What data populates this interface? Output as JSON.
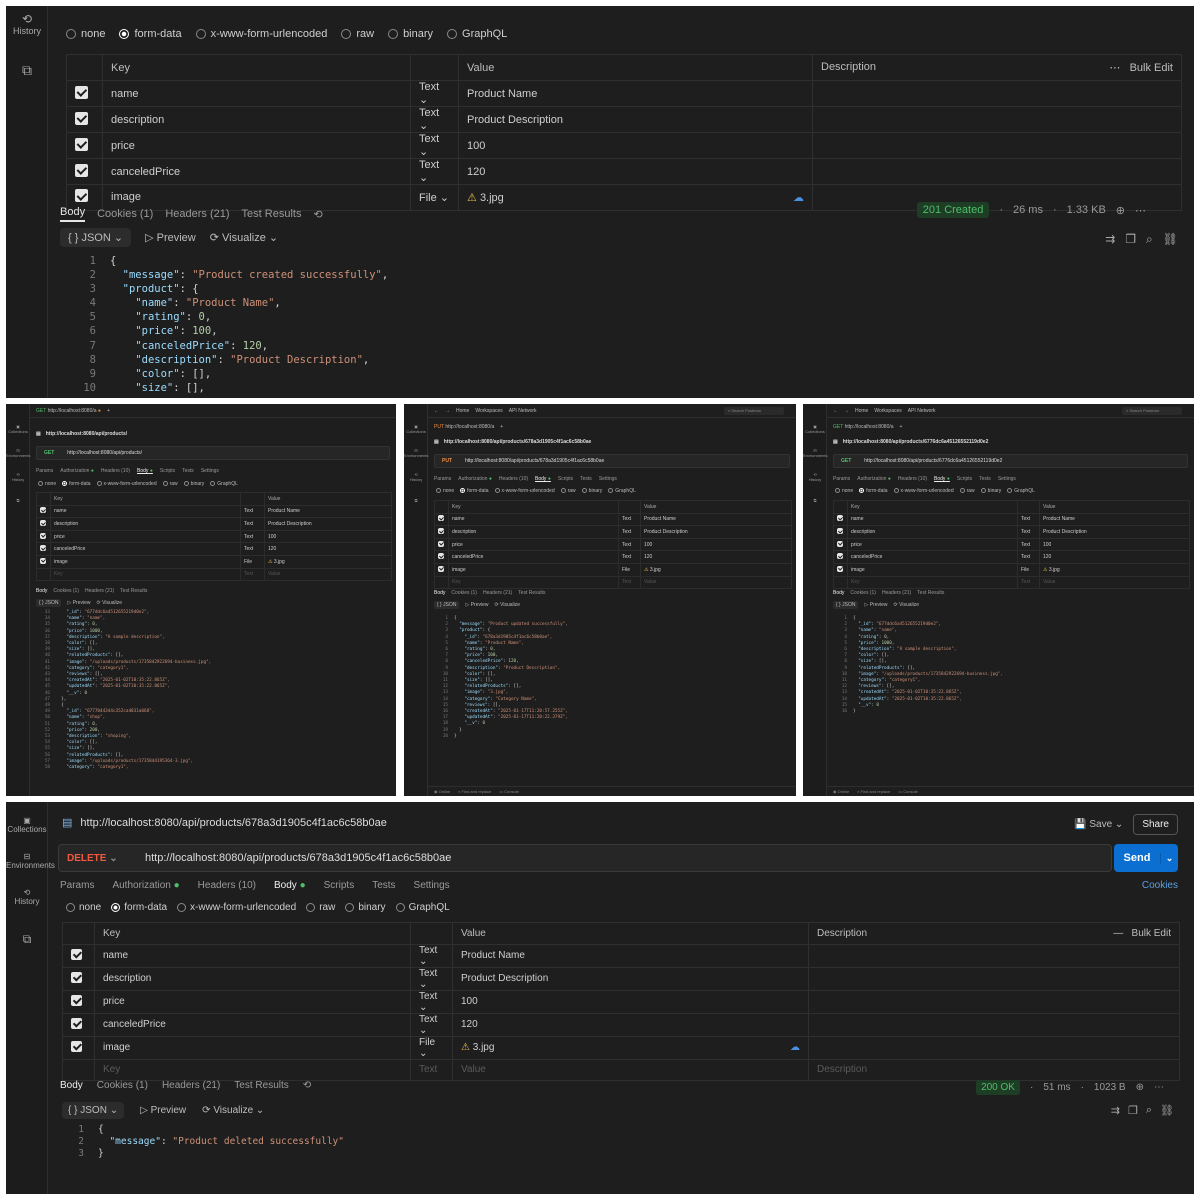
{
  "panel1": {
    "sidebar": {
      "history": "History"
    },
    "body_types": [
      "none",
      "form-data",
      "x-www-form-urlencoded",
      "raw",
      "binary",
      "GraphQL"
    ],
    "selected_body_type": "form-data",
    "table_headers": {
      "key": "Key",
      "value": "Value",
      "description": "Description",
      "bulk": "Bulk Edit"
    },
    "rows": [
      {
        "key": "name",
        "type": "Text",
        "value": "Product Name"
      },
      {
        "key": "description",
        "type": "Text",
        "value": "Product Description"
      },
      {
        "key": "price",
        "type": "Text",
        "value": "100"
      },
      {
        "key": "canceledPrice",
        "type": "Text",
        "value": "120"
      },
      {
        "key": "image",
        "type": "File",
        "value": "3.jpg"
      }
    ],
    "response_tabs": [
      "Body",
      "Cookies (1)",
      "Headers (21)",
      "Test Results"
    ],
    "status": "201 Created",
    "time": "26 ms",
    "size": "1.33 KB",
    "view": {
      "format": "JSON",
      "preview": "Preview",
      "visualize": "Visualize"
    },
    "code": [
      {
        "ln": "1",
        "t": "{"
      },
      {
        "ln": "2",
        "k": "\"message\"",
        "v": "\"Product created successfully\"",
        "e": ","
      },
      {
        "ln": "3",
        "k": "\"product\"",
        "v": "",
        "e": "{"
      },
      {
        "ln": "4",
        "k": "\"name\"",
        "v": "\"Product Name\"",
        "e": ",",
        "i": 2
      },
      {
        "ln": "5",
        "k": "\"rating\"",
        "n": "0",
        "e": ",",
        "i": 2
      },
      {
        "ln": "6",
        "k": "\"price\"",
        "n": "100",
        "e": ",",
        "i": 2
      },
      {
        "ln": "7",
        "k": "\"canceledPrice\"",
        "n": "120",
        "e": ",",
        "i": 2
      },
      {
        "ln": "8",
        "k": "\"description\"",
        "v": "\"Product Description\"",
        "e": ",",
        "i": 2
      },
      {
        "ln": "9",
        "k": "\"color\"",
        "e": "[],",
        "i": 2
      },
      {
        "ln": "10",
        "k": "\"size\"",
        "e": "[],",
        "i": 2
      }
    ]
  },
  "panel2": {
    "tab": "http://localhost:8080/a",
    "title": "http://localhost:8080/api/products/",
    "method": "GET",
    "url": "http://localhost:8080/api/products/",
    "req_tabs": [
      "Params",
      "Authorization",
      "Headers (10)",
      "Body",
      "Scripts",
      "Tests",
      "Settings"
    ],
    "rows": [
      {
        "key": "name",
        "type": "Text",
        "value": "Product Name"
      },
      {
        "key": "description",
        "type": "Text",
        "value": "Product Description"
      },
      {
        "key": "price",
        "type": "Text",
        "value": "100"
      },
      {
        "key": "canceledPrice",
        "type": "Text",
        "value": "120"
      },
      {
        "key": "image",
        "type": "File",
        "value": "3.jpg"
      }
    ],
    "resp_tabs": [
      "Body",
      "Cookies (1)",
      "Headers (21)",
      "Test Results"
    ],
    "code": [
      {
        "ln": "33",
        "t": "    \"_id\": \"677ddc6a4512655219d0e2\","
      },
      {
        "ln": "34",
        "t": "    \"name\": \"name\","
      },
      {
        "ln": "35",
        "t": "    \"rating\": 0,"
      },
      {
        "ln": "36",
        "t": "    \"price\": 1000,"
      },
      {
        "ln": "37",
        "t": "    \"description\": \"A sample description\","
      },
      {
        "ln": "38",
        "t": "    \"color\": [],"
      },
      {
        "ln": "39",
        "t": "    \"size\": [],"
      },
      {
        "ln": "40",
        "t": "    \"relatedProducts\": [],"
      },
      {
        "ln": "41",
        "t": "    \"image\": \"/uploads/products/1735842922694-business.jpg\","
      },
      {
        "ln": "42",
        "t": "    \"category\": \"category1\","
      },
      {
        "ln": "43",
        "t": "    \"reviews\": [],"
      },
      {
        "ln": "44",
        "t": "    \"createdAt\": \"2025-01-02T10:35:22.865Z\","
      },
      {
        "ln": "45",
        "t": "    \"updatedAt\": \"2025-01-02T10:35:22.865Z\","
      },
      {
        "ln": "46",
        "t": "    \"__v\": 0"
      },
      {
        "ln": "47",
        "t": "  },"
      },
      {
        "ln": "48",
        "t": "  {"
      },
      {
        "ln": "49",
        "t": "    \"_id\": \"6777044344c352ca4831a068\","
      },
      {
        "ln": "50",
        "t": "    \"name\": \"shop\","
      },
      {
        "ln": "51",
        "t": "    \"rating\": 0,"
      },
      {
        "ln": "52",
        "t": "    \"price\": 200,"
      },
      {
        "ln": "53",
        "t": "    \"description\": \"shoping\","
      },
      {
        "ln": "54",
        "t": "    \"color\": [],"
      },
      {
        "ln": "55",
        "t": "    \"size\": [],"
      },
      {
        "ln": "56",
        "t": "    \"relatedProducts\": [],"
      },
      {
        "ln": "57",
        "t": "    \"image\": \"/uploads/products/1735844195364-3.jpg\","
      },
      {
        "ln": "58",
        "t": "    \"category\": \"category1\","
      }
    ]
  },
  "panel3": {
    "nav": [
      "Home",
      "Workspaces",
      "API Network"
    ],
    "search": "Search Postman",
    "tab": "http://localhost:8080/a",
    "title": "http://localhost:8080/api/products/678a3d1905c4f1ac6c58b0ae",
    "method": "PUT",
    "url": "http://localhost:8080/api/products/678a3d1905c4f1ac6c58b0ae",
    "code": [
      {
        "ln": "1",
        "t": "{"
      },
      {
        "ln": "2",
        "t": "  \"message\": \"Product updated successfully\","
      },
      {
        "ln": "3",
        "t": "  \"product\": {"
      },
      {
        "ln": "4",
        "t": "    \"_id\": \"678a3d1905c4f1ac6c58b0ae\","
      },
      {
        "ln": "5",
        "t": "    \"name\": \"Product Name\","
      },
      {
        "ln": "6",
        "t": "    \"rating\": 0,"
      },
      {
        "ln": "7",
        "t": "    \"price\": 100,"
      },
      {
        "ln": "8",
        "t": "    \"canceledPrice\": 120,"
      },
      {
        "ln": "9",
        "t": "    \"description\": \"Product Description\","
      },
      {
        "ln": "10",
        "t": "    \"color\": [],"
      },
      {
        "ln": "11",
        "t": "    \"size\": [],"
      },
      {
        "ln": "12",
        "t": "    \"relatedProducts\": [],"
      },
      {
        "ln": "13",
        "t": "    \"image\": \"3.jpg\","
      },
      {
        "ln": "14",
        "t": "    \"category\": \"Category Name\","
      },
      {
        "ln": "15",
        "t": "    \"reviews\": [],"
      },
      {
        "ln": "16",
        "t": "    \"createdAt\": \"2025-01-17T11:20:57.255Z\","
      },
      {
        "ln": "17",
        "t": "    \"updatedAt\": \"2025-01-17T11:20:22.379Z\","
      },
      {
        "ln": "18",
        "t": "    \"__v\": 0"
      },
      {
        "ln": "19",
        "t": "  }"
      },
      {
        "ln": "20",
        "t": "}"
      }
    ],
    "footer": [
      "Online",
      "Find and replace",
      "Console"
    ]
  },
  "panel4": {
    "title": "http://localhost:8080/api/products/6776dc6a45126552119d0e2",
    "method": "GET",
    "url": "http://localhost:8080/api/products/6776dc6a45126552119d0e2",
    "code": [
      {
        "ln": "1",
        "t": "{"
      },
      {
        "ln": "2",
        "t": "  \"_id\": \"677ddc6a4512655219d0e2\","
      },
      {
        "ln": "3",
        "t": "  \"name\": \"name\","
      },
      {
        "ln": "4",
        "t": "  \"rating\": 0,"
      },
      {
        "ln": "5",
        "t": "  \"price\": 1000,"
      },
      {
        "ln": "6",
        "t": "  \"description\": \"A sample description\","
      },
      {
        "ln": "7",
        "t": "  \"color\": [],"
      },
      {
        "ln": "8",
        "t": "  \"size\": [],"
      },
      {
        "ln": "9",
        "t": "  \"relatedProducts\": [],"
      },
      {
        "ln": "10",
        "t": "  \"image\": \"/uploads/products/1735842922694-business.jpg\","
      },
      {
        "ln": "11",
        "t": "  \"category\": \"category1\","
      },
      {
        "ln": "12",
        "t": "  \"reviews\": [],"
      },
      {
        "ln": "13",
        "t": "  \"createdAt\": \"2025-01-02T10:35:22.865Z\","
      },
      {
        "ln": "14",
        "t": "  \"updatedAt\": \"2025-01-02T10:35:22.865Z\","
      },
      {
        "ln": "15",
        "t": "  \"__v\": 0"
      },
      {
        "ln": "16",
        "t": "}"
      }
    ]
  },
  "panel5": {
    "sidebar": [
      "Collections",
      "Environments",
      "History"
    ],
    "title": "http://localhost:8080/api/products/678a3d1905c4f1ac6c58b0ae",
    "save": "Save",
    "share": "Share",
    "method": "DELETE",
    "url": "http://localhost:8080/api/products/678a3d1905c4f1ac6c58b0ae",
    "send": "Send",
    "req_tabs": [
      "Params",
      "Authorization",
      "Headers (10)",
      "Body",
      "Scripts",
      "Tests",
      "Settings"
    ],
    "cookies": "Cookies",
    "body_types": [
      "none",
      "form-data",
      "x-www-form-urlencoded",
      "raw",
      "binary",
      "GraphQL"
    ],
    "headers": {
      "key": "Key",
      "value": "Value",
      "description": "Description",
      "bulk": "Bulk Edit"
    },
    "rows": [
      {
        "key": "name",
        "type": "Text",
        "value": "Product Name"
      },
      {
        "key": "description",
        "type": "Text",
        "value": "Product Description"
      },
      {
        "key": "price",
        "type": "Text",
        "value": "100"
      },
      {
        "key": "canceledPrice",
        "type": "Text",
        "value": "120"
      },
      {
        "key": "image",
        "type": "File",
        "value": "3.jpg"
      }
    ],
    "placeholder": {
      "key": "Key",
      "type": "Text",
      "value": "Value",
      "description": "Description"
    },
    "resp_tabs": [
      "Body",
      "Cookies (1)",
      "Headers (21)",
      "Test Results"
    ],
    "status": "200 OK",
    "time": "51 ms",
    "size": "1023 B",
    "view": {
      "format": "JSON",
      "preview": "Preview",
      "visualize": "Visualize"
    },
    "code": [
      {
        "ln": "1",
        "t": "{"
      },
      {
        "ln": "2",
        "k": "\"message\"",
        "v": "\"Product deleted successfully\""
      },
      {
        "ln": "3",
        "t": "}"
      }
    ]
  }
}
